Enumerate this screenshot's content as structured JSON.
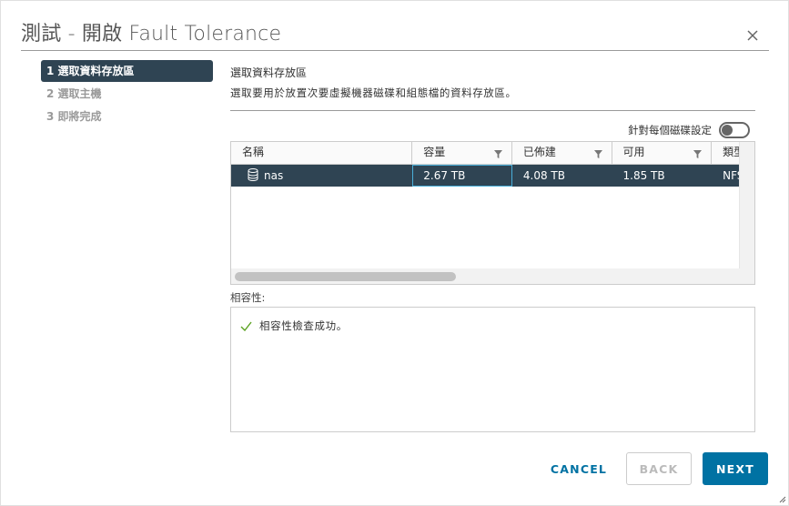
{
  "dialog": {
    "title": "測試 - 開啟 Fault Tolerance"
  },
  "steps": [
    {
      "label": "1 選取資料存放區",
      "active": true
    },
    {
      "label": "2 選取主機",
      "active": false
    },
    {
      "label": "3 即將完成",
      "active": false
    }
  ],
  "main": {
    "heading": "選取資料存放區",
    "description": "選取要用於放置次要虛擬機器磁碟和組態檔的資料存放區。",
    "per_disk_toggle_label": "針對每個磁碟設定",
    "per_disk_toggle_on": false
  },
  "grid": {
    "columns": [
      "名稱",
      "容量",
      "已佈建",
      "可用",
      "類型"
    ],
    "rows": [
      {
        "name": "nas",
        "capacity": "2.67 TB",
        "provisioned": "4.08 TB",
        "free": "1.85 TB",
        "type": "NFS",
        "selected": true
      }
    ]
  },
  "compatibility": {
    "label": "相容性:",
    "message": "相容性檢查成功。",
    "status_icon": "check-icon",
    "status_color": "#5aa220"
  },
  "footer": {
    "cancel": "CANCEL",
    "back": "BACK",
    "next": "NEXT"
  }
}
